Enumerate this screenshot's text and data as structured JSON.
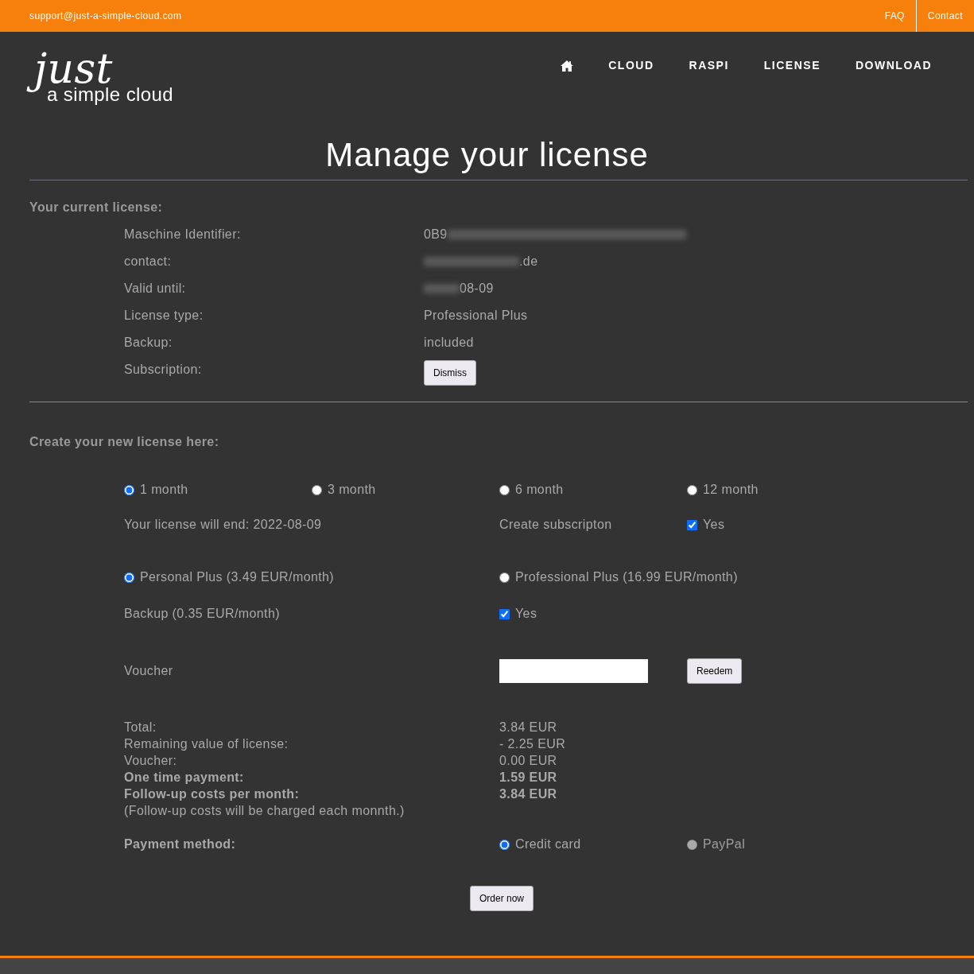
{
  "top_bar": {
    "email": "support@just-a-simple-cloud.com",
    "links": [
      "FAQ",
      "Contact"
    ]
  },
  "header": {
    "logo": {
      "word": "just",
      "tagline": "a simple cloud"
    },
    "nav": [
      {
        "kind": "home"
      },
      {
        "kind": "text",
        "label": "CLOUD"
      },
      {
        "kind": "text",
        "label": "RASPI"
      },
      {
        "kind": "text",
        "label": "LICENSE"
      },
      {
        "kind": "text",
        "label": "DOWNLOAD"
      }
    ]
  },
  "page_title": "Manage your license",
  "current_license": {
    "heading": "Your current license:",
    "rows": [
      {
        "label": "Maschine Identifier:",
        "kind": "text",
        "parts": [
          {
            "kind": "text",
            "text": "0B9"
          },
          {
            "kind": "blurred"
          }
        ]
      },
      {
        "label": "contact:",
        "kind": "text",
        "parts": [
          {
            "kind": "blurred"
          },
          {
            "kind": "text",
            "text": ".de"
          }
        ]
      },
      {
        "label": "Valid until:",
        "kind": "text",
        "parts": [
          {
            "kind": "blurred"
          },
          {
            "kind": "text",
            "text": "08-09"
          }
        ]
      },
      {
        "label": "License type:",
        "kind": "text",
        "parts": [
          {
            "kind": "text",
            "text": "Professional Plus"
          }
        ]
      },
      {
        "label": "Backup:",
        "kind": "text",
        "parts": [
          {
            "kind": "text",
            "text": "included"
          }
        ]
      },
      {
        "label": "Subscription:",
        "kind": "button",
        "button": "Dismiss"
      }
    ]
  },
  "new_license": {
    "heading": "Create your new license here:",
    "durations": [
      {
        "label": "1 month",
        "selected": true
      },
      {
        "label": "3 month",
        "selected": false
      },
      {
        "label": "6 month",
        "selected": false
      },
      {
        "label": "12 month",
        "selected": false
      }
    ],
    "license_end": "Your license will end: 2022-08-09",
    "subscription": {
      "label": "Create subscripton",
      "checkbox_label": "Yes",
      "checked": true
    },
    "plans": [
      {
        "label": "Personal Plus (3.49 EUR/month)",
        "selected": true
      },
      {
        "label": "Professional Plus (16.99 EUR/month)",
        "selected": false
      }
    ],
    "backup": {
      "label": "Backup (0.35 EUR/month)",
      "checkbox_label": "Yes",
      "checked": true
    },
    "voucher": {
      "label": "Voucher",
      "button": "Reedem"
    },
    "summary": [
      {
        "label": "Total:",
        "value": "3.84 EUR",
        "bold": false
      },
      {
        "label": "Remaining value of license:",
        "value": "- 2.25 EUR",
        "bold": false
      },
      {
        "label": "Voucher:",
        "value": "0.00 EUR",
        "bold": false
      },
      {
        "label": "One time payment:",
        "value": "1.59 EUR",
        "bold": true
      },
      {
        "label": "Follow-up costs per month:",
        "value": "3.84 EUR",
        "bold": true
      }
    ],
    "note": "(Follow-up costs will be charged each monnth.)",
    "payment": {
      "label": "Payment method:",
      "options": [
        {
          "label": "Credit card",
          "selected": true,
          "disabled": false
        },
        {
          "label": "PayPal",
          "selected": false,
          "disabled": true
        }
      ]
    },
    "order_button": "Order now"
  }
}
